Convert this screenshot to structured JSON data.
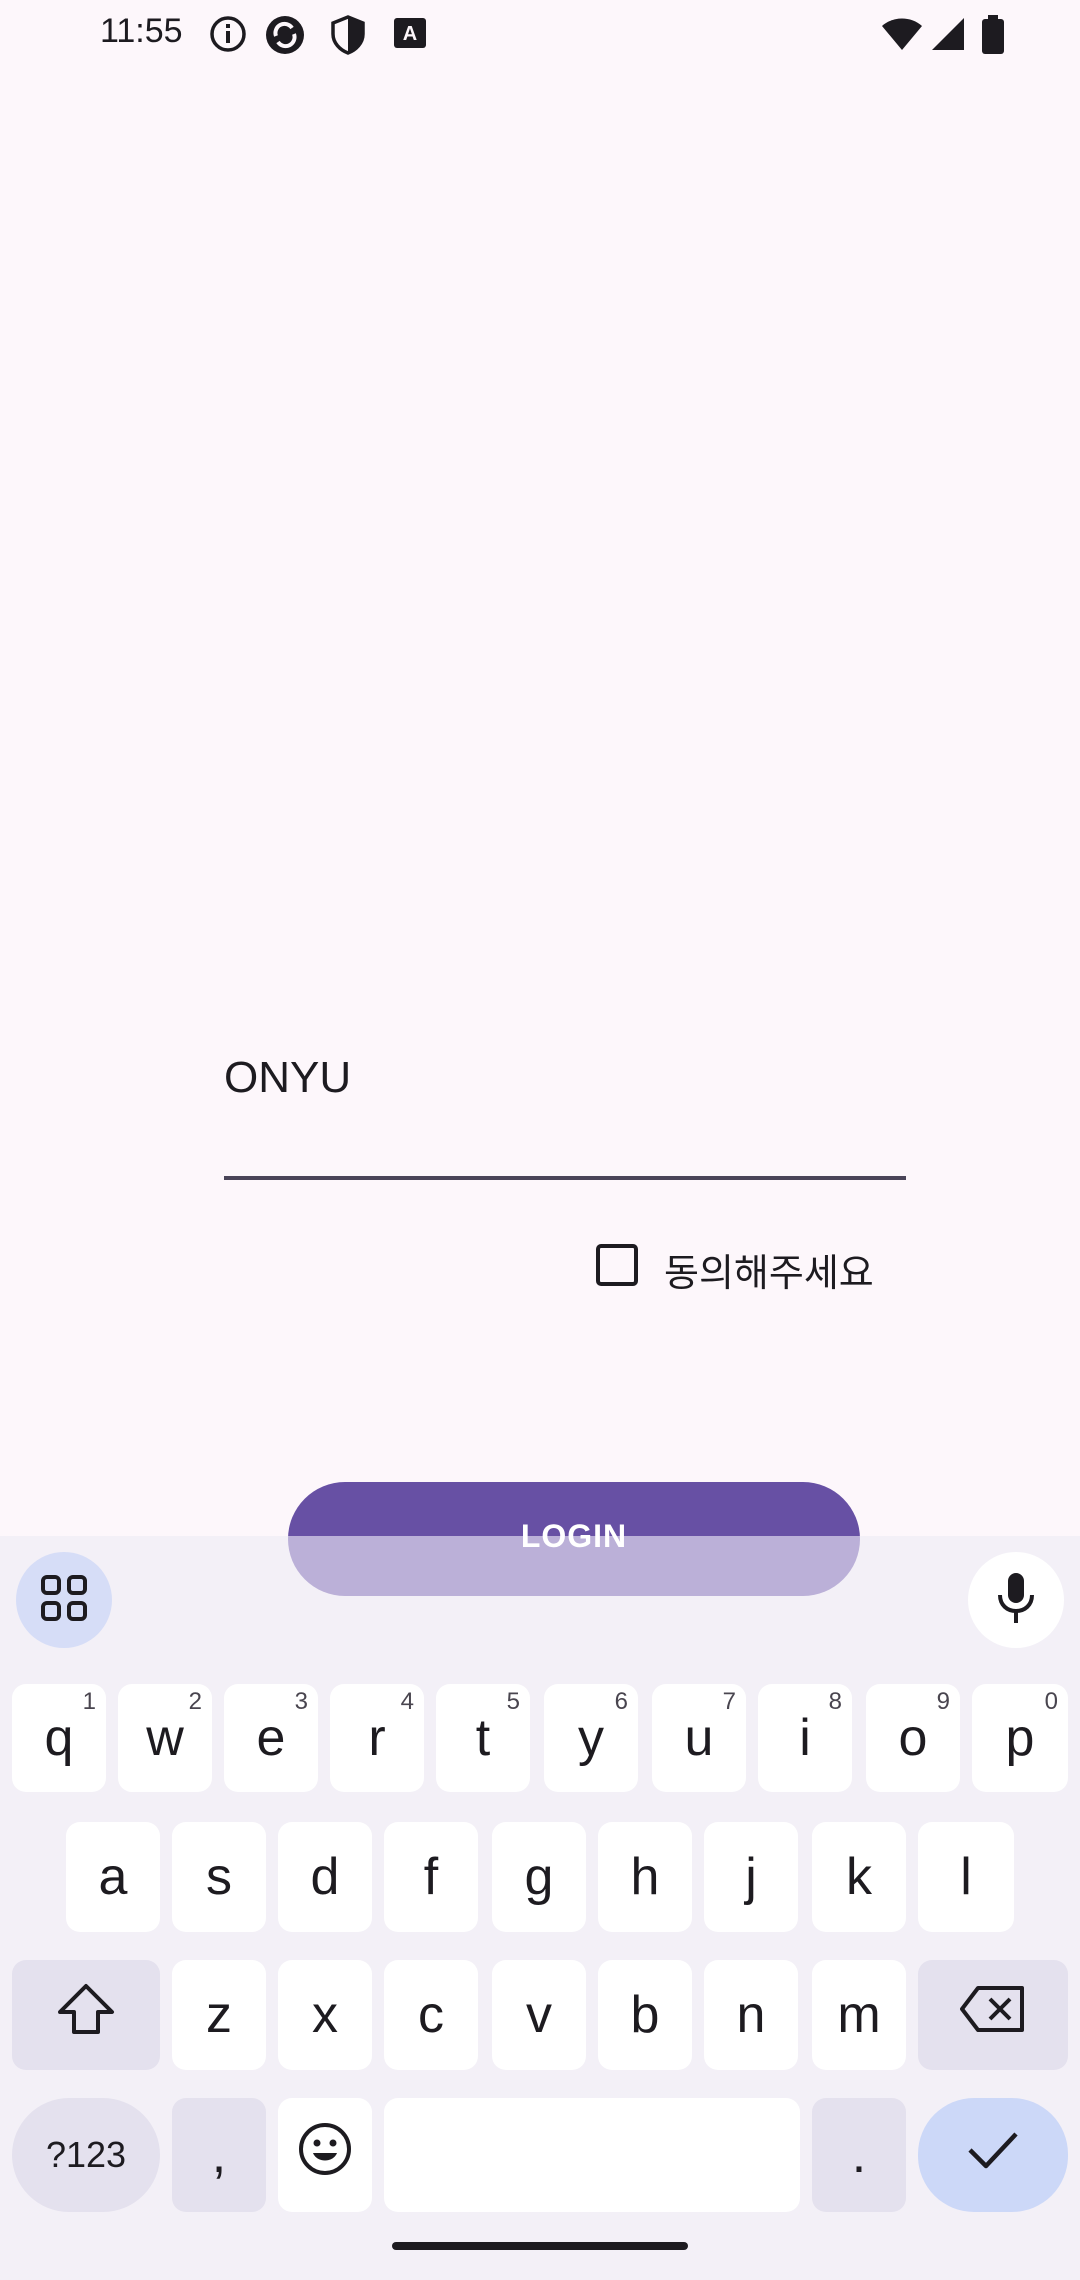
{
  "status_bar": {
    "time": "11:55",
    "left_icons": [
      "info-icon",
      "sync-icon",
      "shield-icon",
      "text-app-icon"
    ],
    "right_icons": [
      "wifi-icon",
      "signal-icon",
      "battery-icon"
    ]
  },
  "form": {
    "username_value": "ONYU",
    "agree_label": "동의해주세요",
    "agree_checked": false,
    "login_label": "LOGIN"
  },
  "keyboard": {
    "row1": [
      {
        "key": "q",
        "hint": "1"
      },
      {
        "key": "w",
        "hint": "2"
      },
      {
        "key": "e",
        "hint": "3"
      },
      {
        "key": "r",
        "hint": "4"
      },
      {
        "key": "t",
        "hint": "5"
      },
      {
        "key": "y",
        "hint": "6"
      },
      {
        "key": "u",
        "hint": "7"
      },
      {
        "key": "i",
        "hint": "8"
      },
      {
        "key": "o",
        "hint": "9"
      },
      {
        "key": "p",
        "hint": "0"
      }
    ],
    "row2": [
      "a",
      "s",
      "d",
      "f",
      "g",
      "h",
      "j",
      "k",
      "l"
    ],
    "row3": [
      "z",
      "x",
      "c",
      "v",
      "b",
      "n",
      "m"
    ],
    "symbols_label": "?123",
    "comma": ",",
    "period": ".",
    "accent_color": "#CCD8F8"
  }
}
